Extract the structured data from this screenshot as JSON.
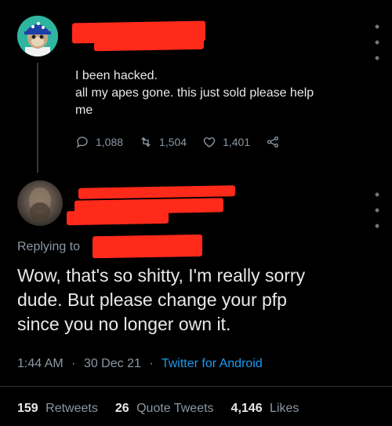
{
  "tweet1": {
    "lines": [
      "I been hacked.",
      "all my apes gone. this just sold please help",
      "me"
    ],
    "actions": {
      "reply_count": "1,088",
      "retweet_count": "1,504",
      "like_count": "1,401"
    }
  },
  "tweet2": {
    "replying_to": "Replying to",
    "text_lines": [
      "Wow, that's so shitty, I'm really sorry",
      "dude. But please change your pfp",
      "since you no longer own it."
    ],
    "time": "1:44 AM",
    "date": "30 Dec 21",
    "client": "Twitter for Android",
    "dot": "·",
    "stats": {
      "retweets_value": "159",
      "retweets_label": "Retweets",
      "quotes_value": "26",
      "quotes_label": "Quote Tweets",
      "likes_value": "4,146",
      "likes_label": "Likes"
    }
  },
  "colors": {
    "background": "#000000",
    "text": "#e7e9ea",
    "muted": "#8b98a5",
    "link": "#1d9bf0",
    "redaction": "#ff2a1a"
  }
}
